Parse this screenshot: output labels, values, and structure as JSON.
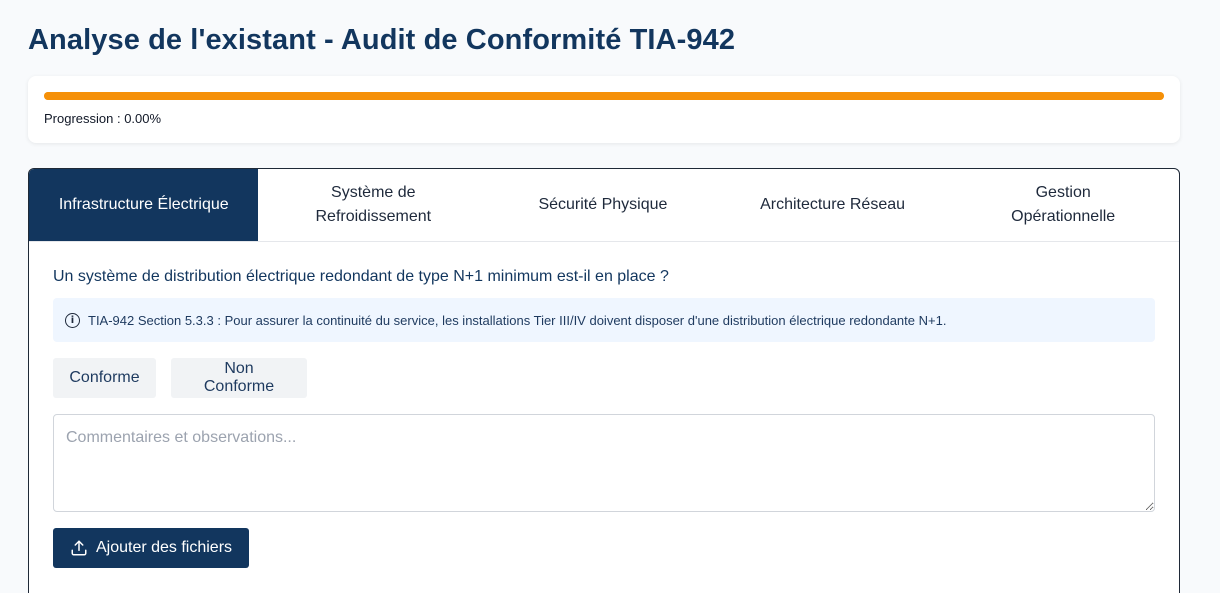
{
  "page": {
    "title": "Analyse de l'existant - Audit de Conformité TIA-942"
  },
  "progress": {
    "label": "Progression : 0.00%",
    "value_percent": 0.0,
    "bar_color": "#f59008"
  },
  "colors": {
    "primary": "#12365e",
    "info_bg": "#eff6ff"
  },
  "tabs": [
    {
      "label": "Infrastructure Électrique",
      "active": true
    },
    {
      "label": "Système de Refroidissement",
      "active": false
    },
    {
      "label": "Sécurité Physique",
      "active": false
    },
    {
      "label": "Architecture Réseau",
      "active": false
    },
    {
      "label": "Gestion Opérationnelle",
      "active": false
    }
  ],
  "question": {
    "text": "Un système de distribution électrique redondant de type N+1 minimum est-il en place ?",
    "info_icon": "info-icon",
    "info_text": "TIA-942 Section 5.3.3 : Pour assurer la continuité du service, les installations Tier III/IV doivent disposer d'une distribution électrique redondante N+1."
  },
  "choices": {
    "conforme": "Conforme",
    "non_conforme": "Non Conforme"
  },
  "comment": {
    "placeholder": "Commentaires et observations...",
    "value": ""
  },
  "upload": {
    "icon": "upload-icon",
    "label": "Ajouter des fichiers"
  }
}
